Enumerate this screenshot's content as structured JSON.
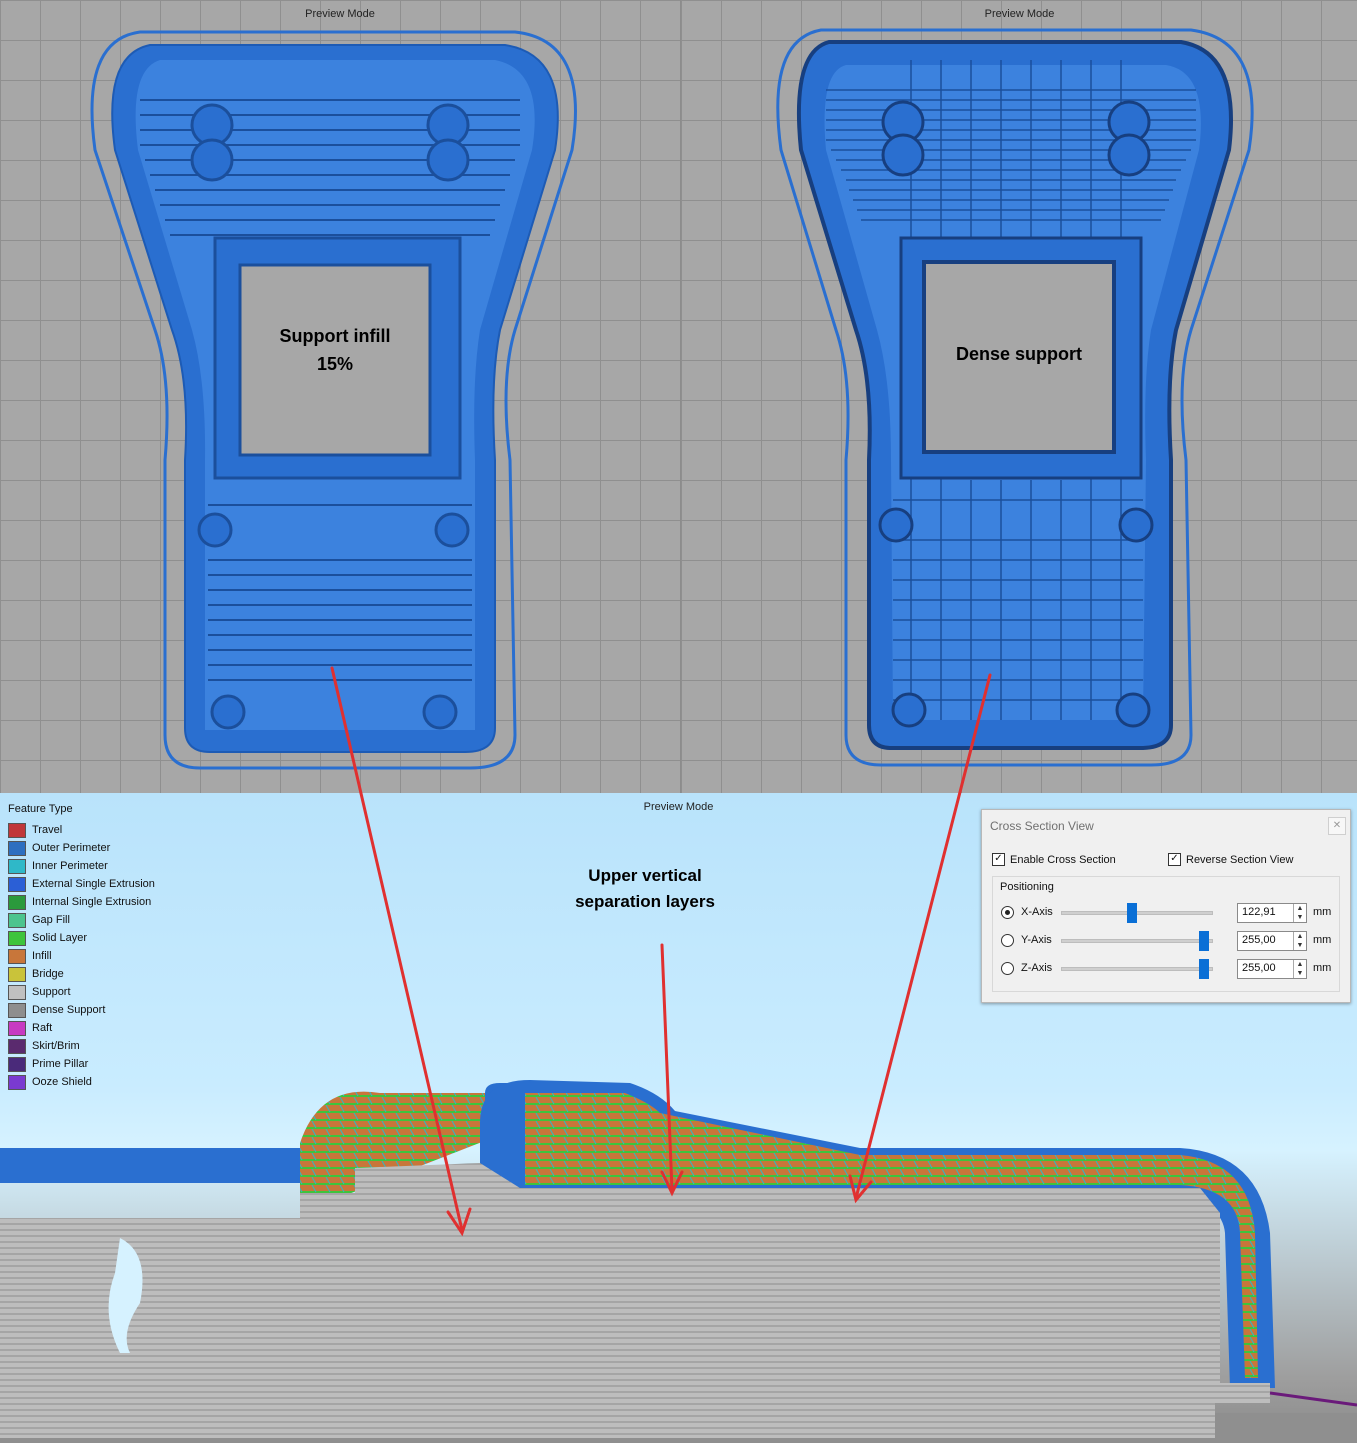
{
  "viewports": {
    "left": {
      "mode": "Preview Mode",
      "annotation": "Support infill\n15%"
    },
    "right": {
      "mode": "Preview Mode",
      "annotation": "Dense support"
    },
    "bottom": {
      "mode": "Preview Mode",
      "annotation": "Upper vertical\nseparation layers"
    }
  },
  "legend": {
    "title": "Feature Type",
    "items": [
      {
        "label": "Travel",
        "color": "#c0373a"
      },
      {
        "label": "Outer Perimeter",
        "color": "#2e6fc0"
      },
      {
        "label": "Inner Perimeter",
        "color": "#2fb8c8"
      },
      {
        "label": "External Single Extrusion",
        "color": "#2b5fd6"
      },
      {
        "label": "Internal Single Extrusion",
        "color": "#2b9a3c"
      },
      {
        "label": "Gap Fill",
        "color": "#4cc48e"
      },
      {
        "label": "Solid Layer",
        "color": "#3ec43c"
      },
      {
        "label": "Infill",
        "color": "#c8763a"
      },
      {
        "label": "Bridge",
        "color": "#c9c33a"
      },
      {
        "label": "Support",
        "color": "#c0c0c0"
      },
      {
        "label": "Dense Support",
        "color": "#8e8e8e"
      },
      {
        "label": "Raft",
        "color": "#c73ac2"
      },
      {
        "label": "Skirt/Brim",
        "color": "#5a2a6e"
      },
      {
        "label": "Prime Pillar",
        "color": "#4a2a7a"
      },
      {
        "label": "Ooze Shield",
        "color": "#7a3ad0"
      }
    ]
  },
  "cross_section": {
    "title": "Cross Section View",
    "enable_label": "Enable Cross Section",
    "enable_checked": true,
    "reverse_label": "Reverse Section View",
    "reverse_checked": true,
    "positioning_label": "Positioning",
    "axes": [
      {
        "label": "X-Axis",
        "value": "122,91",
        "unit": "mm",
        "selected": true,
        "slider_fraction": 0.48
      },
      {
        "label": "Y-Axis",
        "value": "255,00",
        "unit": "mm",
        "selected": false,
        "slider_fraction": 1.0
      },
      {
        "label": "Z-Axis",
        "value": "255,00",
        "unit": "mm",
        "selected": false,
        "slider_fraction": 1.0
      }
    ]
  },
  "colors": {
    "model_blue": "#2a6fd0",
    "support_gray": "#bdbdbd",
    "arrow_red": "#e03030"
  }
}
